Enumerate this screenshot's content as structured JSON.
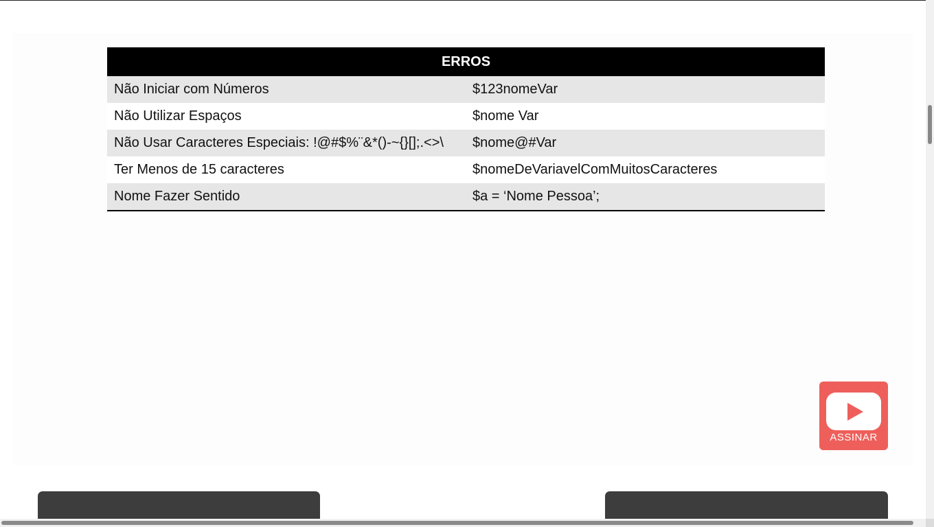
{
  "table": {
    "header": "ERROS",
    "rows": [
      {
        "rule": "Não Iniciar com Números",
        "example": "$123nomeVar"
      },
      {
        "rule": "Não Utilizar Espaços",
        "example": "$nome Var"
      },
      {
        "rule": "Não Usar Caracteres Especiais: !@#$%¨&*()-~{}[];.<>\\",
        "example": "$nome@#Var"
      },
      {
        "rule": "Ter Menos de 15 caracteres",
        "example": "$nomeDeVariavelComMuitosCaracteres"
      },
      {
        "rule": "Nome Fazer Sentido",
        "example": "$a = ‘Nome Pessoa’;"
      }
    ]
  },
  "subscribe": {
    "label": "ASSINAR",
    "icon": "youtube-play-icon",
    "color": "#ee5f5b"
  },
  "colors": {
    "header_bg": "#000000",
    "row_shade": "#e6e6e6",
    "card": "#3d3d3d"
  }
}
